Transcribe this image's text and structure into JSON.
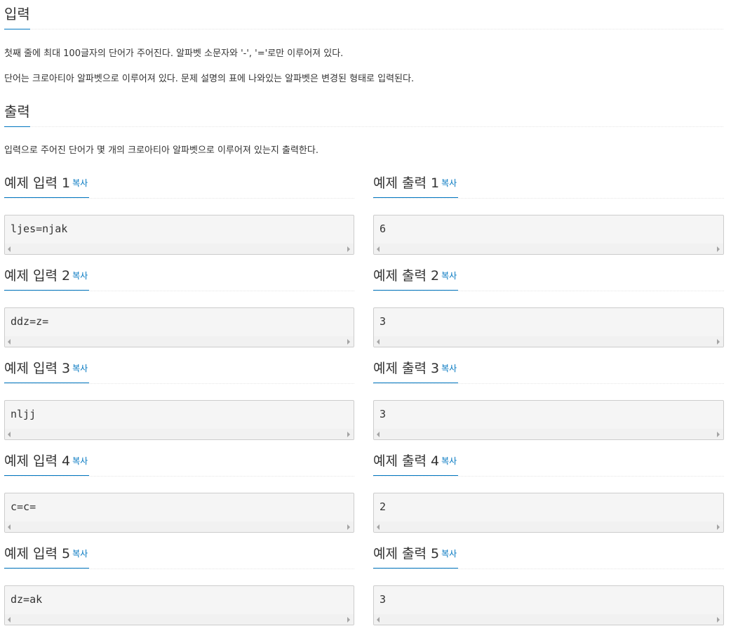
{
  "input_section": {
    "title": "입력",
    "paragraphs": [
      "첫째 줄에 최대 100글자의 단어가 주어진다. 알파벳 소문자와 '-', '='로만 이루어져 있다.",
      "단어는 크로아티아 알파벳으로 이루어져 있다. 문제 설명의 표에 나와있는 알파벳은 변경된 형태로 입력된다."
    ]
  },
  "output_section": {
    "title": "출력",
    "paragraphs": [
      "입력으로 주어진 단어가 몇 개의 크로아티아 알파벳으로 이루어져 있는지 출력한다."
    ]
  },
  "copy_label": "복사",
  "samples": [
    {
      "input_title": "예제 입력 1",
      "input": "ljes=njak",
      "output_title": "예제 출력 1",
      "output": "6"
    },
    {
      "input_title": "예제 입력 2",
      "input": "ddz=z=",
      "output_title": "예제 출력 2",
      "output": "3"
    },
    {
      "input_title": "예제 입력 3",
      "input": "nljj",
      "output_title": "예제 출력 3",
      "output": "3"
    },
    {
      "input_title": "예제 입력 4",
      "input": "c=c=",
      "output_title": "예제 출력 4",
      "output": "2"
    },
    {
      "input_title": "예제 입력 5",
      "input": "dz=ak",
      "output_title": "예제 출력 5",
      "output": "3"
    }
  ],
  "colors": {
    "accent": "#0076c0",
    "code_bg": "#f5f5f5",
    "text": "#333333"
  }
}
